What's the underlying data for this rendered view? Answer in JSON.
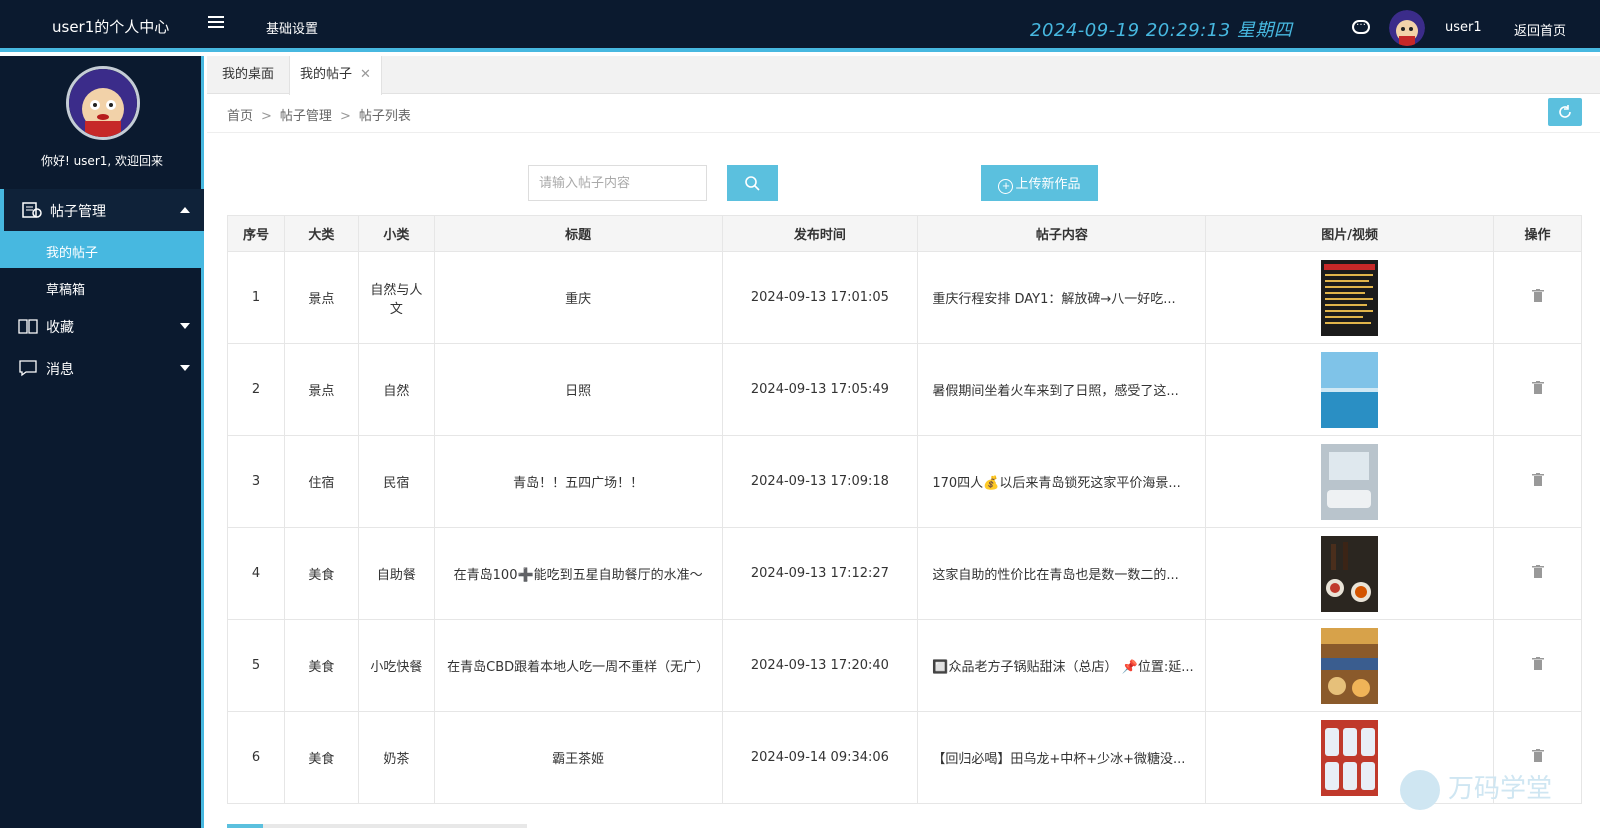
{
  "header": {
    "app_title": "user1的个人中心",
    "nav_basic_settings": "基础设置",
    "datetime": "2024-09-19  20:29:13  星期四",
    "username": "user1",
    "back_home": "返回首页"
  },
  "sidebar": {
    "welcome": "你好! user1, 欢迎回来",
    "groups": [
      {
        "label": "帖子管理",
        "items": [
          {
            "label": "我的帖子"
          },
          {
            "label": "草稿箱"
          }
        ]
      },
      {
        "label": "收藏"
      },
      {
        "label": "消息"
      }
    ]
  },
  "tabs": [
    {
      "label": "我的桌面"
    },
    {
      "label": "我的帖子"
    }
  ],
  "breadcrumb": [
    "首页",
    "帖子管理",
    "帖子列表"
  ],
  "search": {
    "placeholder": "请输入帖子内容"
  },
  "upload_label": "上传新作品",
  "table": {
    "headers": [
      "序号",
      "大类",
      "小类",
      "标题",
      "发布时间",
      "帖子内容",
      "图片/视频",
      "操作"
    ],
    "rows": [
      {
        "no": "1",
        "cat": "景点",
        "sub": "自然与人文",
        "title": "重庆",
        "time": "2024-09-13 17:01:05",
        "content": "重庆行程安排 DAY1：解放碑→八一好吃...",
        "thumb": "dark-list"
      },
      {
        "no": "2",
        "cat": "景点",
        "sub": "自然",
        "title": "日照",
        "time": "2024-09-13 17:05:49",
        "content": "暑假期间坐着火车来到了日照，感受了这...",
        "thumb": "sea"
      },
      {
        "no": "3",
        "cat": "住宿",
        "sub": "民宿",
        "title": "青岛！！五四广场！！",
        "time": "2024-09-13 17:09:18",
        "content": "170四人💰以后来青岛锁死这家平价海景...",
        "thumb": "room"
      },
      {
        "no": "4",
        "cat": "美食",
        "sub": "自助餐",
        "title": "在青岛100➕能吃到五星自助餐厅的水准～",
        "time": "2024-09-13 17:12:27",
        "content": "这家自助的性价比在青岛也是数一数二的...",
        "thumb": "buffet"
      },
      {
        "no": "5",
        "cat": "美食",
        "sub": "小吃快餐",
        "title": "在青岛CBD跟着本地人吃一周不重样（无广）",
        "time": "2024-09-13 17:20:40",
        "content": "🔲众品老方子锅贴甜沫（总店） 📌位置:延...",
        "thumb": "food"
      },
      {
        "no": "6",
        "cat": "美食",
        "sub": "奶茶",
        "title": "霸王茶姬",
        "time": "2024-09-14 09:34:06",
        "content": "【回归必喝】田乌龙+中杯+少冰+微糖没...",
        "thumb": "tea"
      }
    ]
  },
  "watermark": "万码学堂",
  "colors": {
    "header_bg": "#0b1a2f",
    "accent": "#47b8e0",
    "button": "#5bc0de"
  }
}
